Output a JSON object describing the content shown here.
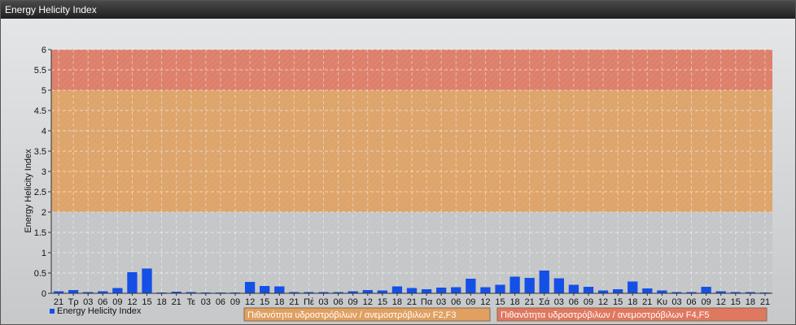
{
  "window": {
    "title": "Energy Helicity Index"
  },
  "chart_data": {
    "type": "bar",
    "ylabel": "Energy Helicity Index",
    "ylim": [
      0,
      6
    ],
    "yticks": [
      "0",
      "0.5",
      "1",
      "1.5",
      "2",
      "2.5",
      "3",
      "3.5",
      "4",
      "4.5",
      "5",
      "5.5",
      "6"
    ],
    "grid": true,
    "legend_position": "bottom-left",
    "categories": [
      "21",
      "Τρ",
      "03",
      "06",
      "09",
      "12",
      "15",
      "18",
      "21",
      "Τε",
      "03",
      "06",
      "09",
      "12",
      "15",
      "18",
      "21",
      "Πέ",
      "03",
      "06",
      "09",
      "12",
      "15",
      "18",
      "21",
      "Πα",
      "03",
      "06",
      "09",
      "12",
      "15",
      "18",
      "21",
      "Σά",
      "03",
      "06",
      "09",
      "12",
      "15",
      "18",
      "21",
      "Κυ",
      "03",
      "06",
      "09",
      "12",
      "15",
      "18",
      "21"
    ],
    "series": [
      {
        "name": "Energy Helicity Index",
        "color": "#1450e6",
        "values": [
          0.05,
          0.08,
          0.03,
          0.05,
          0.13,
          0.52,
          0.61,
          0.02,
          0.04,
          0.03,
          0.02,
          0.02,
          0.02,
          0.28,
          0.18,
          0.17,
          0.03,
          0.03,
          0.03,
          0.03,
          0.05,
          0.08,
          0.07,
          0.17,
          0.13,
          0.1,
          0.14,
          0.15,
          0.36,
          0.15,
          0.21,
          0.41,
          0.38,
          0.56,
          0.37,
          0.21,
          0.16,
          0.07,
          0.1,
          0.29,
          0.12,
          0.07,
          0.03,
          0.03,
          0.16,
          0.05,
          0.03,
          0.03,
          0.02
        ]
      }
    ],
    "bands": [
      {
        "from": 2,
        "to": 5,
        "color": "#e0a060",
        "label": "Πιθανότητα υδροστρόβιλων / ανεμοστρόβιλων F2,F3"
      },
      {
        "from": 5,
        "to": 6,
        "color": "#e07860",
        "label": "Πιθανότητα υδροστρόβιλων / ανεμοστρόβιλων F4,F5"
      }
    ]
  }
}
